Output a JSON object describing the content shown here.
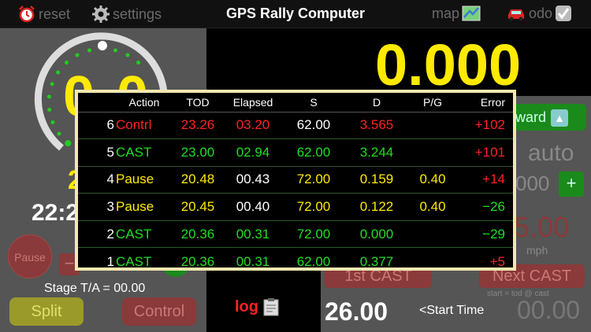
{
  "colors": {
    "yellow": "#ffea00",
    "green": "#22dd22",
    "red": "#ff2222",
    "white": "#ffffff"
  },
  "topbar": {
    "reset_label": "reset",
    "settings_label": "settings",
    "title": "GPS Rally Computer",
    "map_label": "map",
    "odo_label": "odo",
    "icons": [
      "alarm-clock-icon",
      "gear-icon",
      "map-icon",
      "car-icon",
      "checkbox-checked-icon"
    ]
  },
  "left": {
    "big_value": "0.0",
    "partial_value": "2",
    "clock": "22:2",
    "pause_label": "Pause",
    "minus_label": "−",
    "stage_ta": "Stage T/A = 00.00",
    "split_label": "Split",
    "control_label": "Control"
  },
  "middle": {
    "log_label": "log",
    "log_icon": "clipboard-icon"
  },
  "right": {
    "odometer": "0.000",
    "forward_label": "ward",
    "auto_label": "auto",
    "counter": "000",
    "plus_label": "+",
    "speed": "5.00",
    "speed_unit": "mph",
    "first_cast_label": "1st CAST",
    "next_cast_label": "Next CAST",
    "cast_note": "start = tod @ cast",
    "start_value": "26.00",
    "start_label": "<Start Time",
    "start_time": "00.00"
  },
  "log": {
    "headers": [
      "",
      "Action",
      "TOD",
      "Elapsed",
      "S",
      "D",
      "P/G",
      "Error"
    ],
    "rows": [
      {
        "idx": "6",
        "action": "Contrl",
        "tod": "23.26",
        "elapsed": "03.20",
        "s": "62.00",
        "d": "3.565",
        "pg": "",
        "error": "+102",
        "colors": {
          "action": "#ff2222",
          "tod": "#ff2222",
          "elapsed": "#ff2222",
          "s": "#ffffff",
          "d": "#ff2222",
          "pg": "#ffea00",
          "error": "#ff2222"
        }
      },
      {
        "idx": "5",
        "action": "CAST",
        "tod": "23.00",
        "elapsed": "02.94",
        "s": "62.00",
        "d": "3.244",
        "pg": "",
        "error": "+101",
        "colors": {
          "action": "#22dd22",
          "tod": "#22dd22",
          "elapsed": "#22dd22",
          "s": "#22dd22",
          "d": "#22dd22",
          "pg": "#ffea00",
          "error": "#ff2222"
        }
      },
      {
        "idx": "4",
        "action": "Pause",
        "tod": "20.48",
        "elapsed": "00.43",
        "s": "72.00",
        "d": "0.159",
        "pg": "0.40",
        "error": "+14",
        "colors": {
          "action": "#ffea00",
          "tod": "#ffea00",
          "elapsed": "#ffffff",
          "s": "#ffea00",
          "d": "#ffea00",
          "pg": "#ffea00",
          "error": "#ff2222"
        }
      },
      {
        "idx": "3",
        "action": "Pause",
        "tod": "20.45",
        "elapsed": "00.40",
        "s": "72.00",
        "d": "0.122",
        "pg": "0.40",
        "error": "−26",
        "colors": {
          "action": "#ffea00",
          "tod": "#ffea00",
          "elapsed": "#ffffff",
          "s": "#ffea00",
          "d": "#ffea00",
          "pg": "#ffea00",
          "error": "#22dd22"
        }
      },
      {
        "idx": "2",
        "action": "CAST",
        "tod": "20.36",
        "elapsed": "00.31",
        "s": "72.00",
        "d": "0.000",
        "pg": "",
        "error": "−29",
        "colors": {
          "action": "#22dd22",
          "tod": "#22dd22",
          "elapsed": "#22dd22",
          "s": "#22dd22",
          "d": "#22dd22",
          "pg": "#ffea00",
          "error": "#22dd22"
        }
      },
      {
        "idx": "1",
        "action": "CAST",
        "tod": "20.36",
        "elapsed": "00.31",
        "s": "62.00",
        "d": "0.377",
        "pg": "",
        "error": "+5",
        "colors": {
          "action": "#22dd22",
          "tod": "#22dd22",
          "elapsed": "#22dd22",
          "s": "#22dd22",
          "d": "#22dd22",
          "pg": "#ffea00",
          "error": "#ff2222"
        }
      }
    ]
  }
}
